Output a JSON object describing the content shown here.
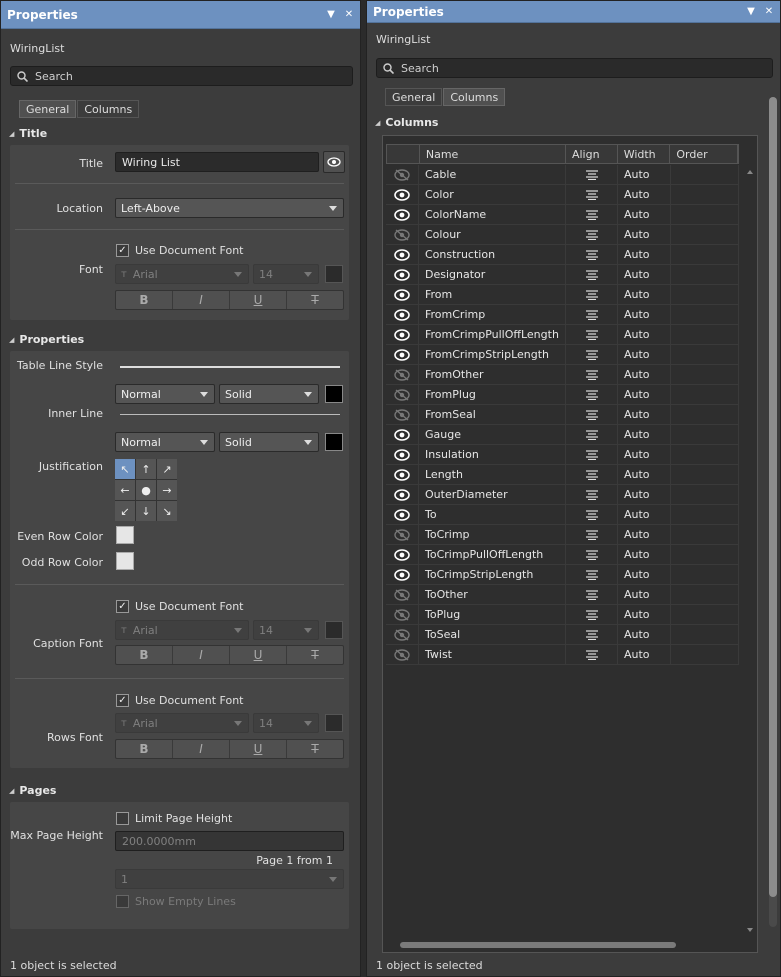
{
  "left": {
    "title": "Properties",
    "object_name": "WiringList",
    "search_placeholder": "Search",
    "tabs": [
      "General",
      "Columns"
    ],
    "sections": {
      "title": "Title",
      "properties": "Properties",
      "pages": "Pages"
    },
    "title_section": {
      "title_label": "Title",
      "title_value": "Wiring List",
      "location_label": "Location",
      "location_value": "Left-Above",
      "font_label": "Font",
      "use_doc_font": "Use Document Font",
      "font_name": "Arial",
      "font_size": "14"
    },
    "properties_section": {
      "table_line_style": "Table Line Style",
      "tls_width": "Normal",
      "tls_style": "Solid",
      "inner_line": "Inner Line",
      "il_width": "Normal",
      "il_style": "Solid",
      "justification": "Justification",
      "even_row_color": "Even Row Color",
      "odd_row_color": "Odd Row Color",
      "caption_font": "Caption Font",
      "caption_use_doc_font": "Use Document Font",
      "caption_font_name": "Arial",
      "caption_font_size": "14",
      "rows_font": "Rows Font",
      "rows_use_doc_font": "Use Document Font",
      "rows_font_name": "Arial",
      "rows_font_size": "14"
    },
    "pages_section": {
      "limit_page_height": "Limit Page Height",
      "max_page_height": "Max Page Height",
      "max_page_height_value": "200.0000mm",
      "page_from": "Page 1 from 1",
      "page_select": "1",
      "show_empty_lines": "Show Empty Lines"
    },
    "status": "1 object is selected"
  },
  "right": {
    "title": "Properties",
    "object_name": "WiringList",
    "search_placeholder": "Search",
    "tabs": [
      "General",
      "Columns"
    ],
    "section": "Columns",
    "headers": [
      "Name",
      "Align",
      "Width",
      "Order"
    ],
    "columns": [
      {
        "name": "Cable",
        "visible": false,
        "width": "Auto"
      },
      {
        "name": "Color",
        "visible": true,
        "width": "Auto"
      },
      {
        "name": "ColorName",
        "visible": true,
        "width": "Auto"
      },
      {
        "name": "Colour",
        "visible": false,
        "width": "Auto"
      },
      {
        "name": "Construction",
        "visible": true,
        "width": "Auto"
      },
      {
        "name": "Designator",
        "visible": true,
        "width": "Auto"
      },
      {
        "name": "From",
        "visible": true,
        "width": "Auto"
      },
      {
        "name": "FromCrimp",
        "visible": true,
        "width": "Auto"
      },
      {
        "name": "FromCrimpPullOffLength",
        "visible": true,
        "width": "Auto"
      },
      {
        "name": "FromCrimpStripLength",
        "visible": true,
        "width": "Auto"
      },
      {
        "name": "FromOther",
        "visible": false,
        "width": "Auto"
      },
      {
        "name": "FromPlug",
        "visible": false,
        "width": "Auto"
      },
      {
        "name": "FromSeal",
        "visible": false,
        "width": "Auto"
      },
      {
        "name": "Gauge",
        "visible": true,
        "width": "Auto"
      },
      {
        "name": "Insulation",
        "visible": true,
        "width": "Auto"
      },
      {
        "name": "Length",
        "visible": true,
        "width": "Auto"
      },
      {
        "name": "OuterDiameter",
        "visible": true,
        "width": "Auto"
      },
      {
        "name": "To",
        "visible": true,
        "width": "Auto"
      },
      {
        "name": "ToCrimp",
        "visible": false,
        "width": "Auto"
      },
      {
        "name": "ToCrimpPullOffLength",
        "visible": true,
        "width": "Auto"
      },
      {
        "name": "ToCrimpStripLength",
        "visible": true,
        "width": "Auto"
      },
      {
        "name": "ToOther",
        "visible": false,
        "width": "Auto"
      },
      {
        "name": "ToPlug",
        "visible": false,
        "width": "Auto"
      },
      {
        "name": "ToSeal",
        "visible": false,
        "width": "Auto"
      },
      {
        "name": "Twist",
        "visible": false,
        "width": "Auto"
      }
    ],
    "status": "1 object is selected"
  },
  "colors": {
    "titlebar": "#6d91c0",
    "panel": "#3c3c3c",
    "group": "#464646"
  }
}
